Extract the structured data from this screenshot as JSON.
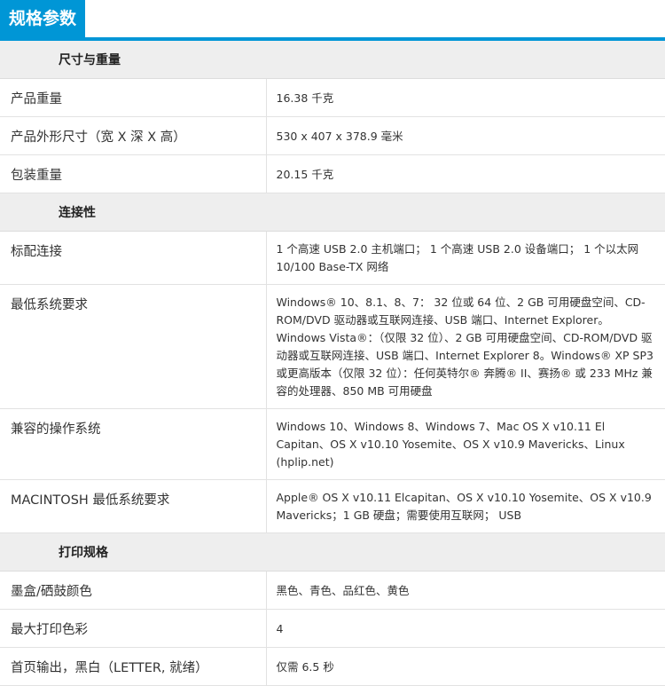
{
  "header": {
    "title": "规格参数"
  },
  "sections": [
    {
      "title": "尺寸与重量",
      "rows": [
        {
          "label": "产品重量",
          "value": "16.38 千克"
        },
        {
          "label": "产品外形尺寸（宽 X 深 X 高）",
          "value": "530 x 407 x 378.9 毫米"
        },
        {
          "label": "包装重量",
          "value": "20.15 千克"
        }
      ]
    },
    {
      "title": "连接性",
      "rows": [
        {
          "label": "标配连接",
          "value": "1 个高速 USB 2.0 主机端口； 1 个高速 USB 2.0 设备端口； 1 个以太网 10/100 Base-TX 网络"
        },
        {
          "label": "最低系统要求",
          "value": "Windows® 10、8.1、8、7： 32 位或 64 位、2 GB 可用硬盘空间、CD-ROM/DVD 驱动器或互联网连接、USB 端口、Internet Explorer。 Windows Vista®：（仅限 32 位）、2 GB 可用硬盘空间、CD-ROM/DVD 驱动器或互联网连接、USB 端口、Internet Explorer 8。Windows® XP SP3 或更高版本（仅限 32 位）：任何英特尔® 奔腾® II、赛扬® 或 233 MHz 兼容的处理器、850 MB 可用硬盘"
        },
        {
          "label": "兼容的操作系统",
          "value": "Windows 10、Windows 8、Windows 7、Mac OS X v10.11 El Capitan、OS X v10.10 Yosemite、OS X v10.9 Mavericks、Linux (hplip.net)"
        },
        {
          "label": "MACINTOSH 最低系统要求",
          "value": "Apple® OS X v10.11 Elcapitan、OS X v10.10 Yosemite、OS X v10.9 Mavericks；1 GB 硬盘；需要使用互联网； USB"
        }
      ]
    },
    {
      "title": "打印规格",
      "rows": [
        {
          "label": "墨盒/硒鼓颜色",
          "value": "黑色、青色、品红色、黄色"
        },
        {
          "label": "最大打印色彩",
          "value": "4"
        },
        {
          "label": "首页输出，黑白（LETTER, 就绪）",
          "value": "仅需 6.5 秒"
        }
      ]
    }
  ]
}
